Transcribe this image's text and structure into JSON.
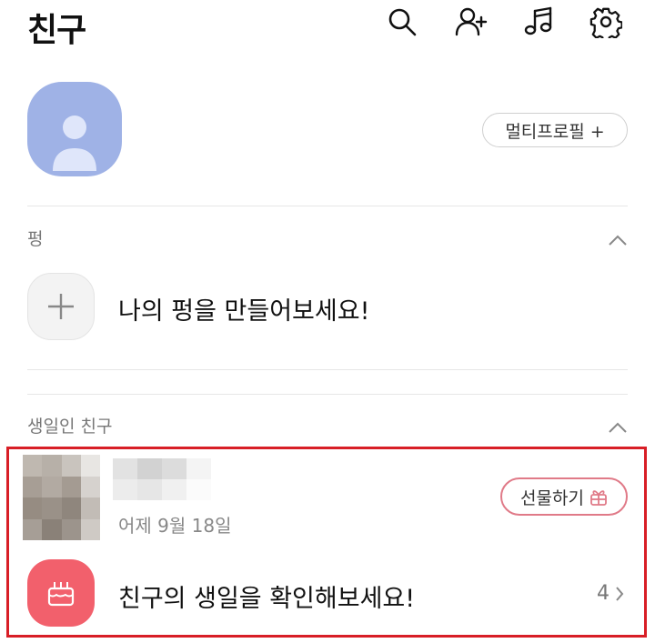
{
  "header": {
    "title": "친구",
    "icons": [
      "search-icon",
      "add-friend-icon",
      "music-icon",
      "settings-icon"
    ]
  },
  "profile": {
    "multi_profile_label": "멀티프로필 +"
  },
  "pung_section": {
    "label": "펑",
    "create_text": "나의 펑을 만들어보세요!"
  },
  "birthday_section": {
    "label": "생일인 친구",
    "friend": {
      "date": "어제 9월 18일",
      "gift_label": "선물하기"
    },
    "check_text": "친구의 생일을 확인해보세요!",
    "count": "4"
  },
  "colors": {
    "avatar_bg": "#9fb2e6",
    "highlight_border": "#d81e26",
    "birthday_icon_bg": "#f2606c",
    "gift_accent": "#e07a88"
  }
}
